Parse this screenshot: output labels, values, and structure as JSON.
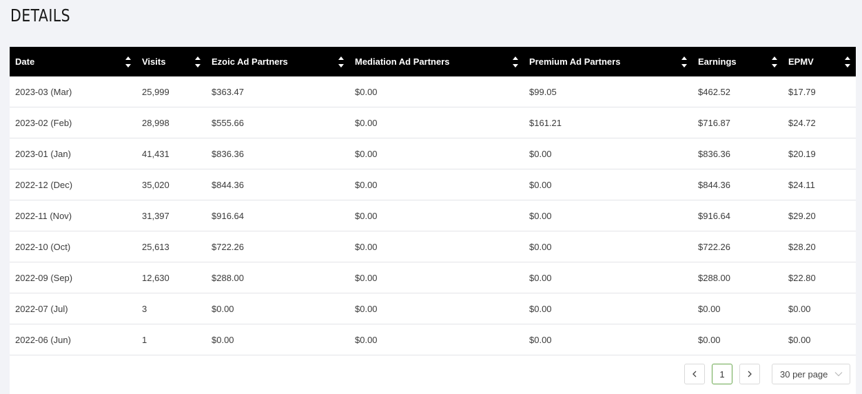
{
  "page": {
    "title": "DETAILS"
  },
  "table": {
    "columns": [
      "Date",
      "Visits",
      "Ezoic Ad Partners",
      "Mediation Ad Partners",
      "Premium Ad Partners",
      "Earnings",
      "EPMV"
    ],
    "rows": [
      [
        "2023-03 (Mar)",
        "25,999",
        "$363.47",
        "$0.00",
        "$99.05",
        "$462.52",
        "$17.79"
      ],
      [
        "2023-02 (Feb)",
        "28,998",
        "$555.66",
        "$0.00",
        "$161.21",
        "$716.87",
        "$24.72"
      ],
      [
        "2023-01 (Jan)",
        "41,431",
        "$836.36",
        "$0.00",
        "$0.00",
        "$836.36",
        "$20.19"
      ],
      [
        "2022-12 (Dec)",
        "35,020",
        "$844.36",
        "$0.00",
        "$0.00",
        "$844.36",
        "$24.11"
      ],
      [
        "2022-11 (Nov)",
        "31,397",
        "$916.64",
        "$0.00",
        "$0.00",
        "$916.64",
        "$29.20"
      ],
      [
        "2022-10 (Oct)",
        "25,613",
        "$722.26",
        "$0.00",
        "$0.00",
        "$722.26",
        "$28.20"
      ],
      [
        "2022-09 (Sep)",
        "12,630",
        "$288.00",
        "$0.00",
        "$0.00",
        "$288.00",
        "$22.80"
      ],
      [
        "2022-07 (Jul)",
        "3",
        "$0.00",
        "$0.00",
        "$0.00",
        "$0.00",
        "$0.00"
      ],
      [
        "2022-06 (Jun)",
        "1",
        "$0.00",
        "$0.00",
        "$0.00",
        "$0.00",
        "$0.00"
      ]
    ]
  },
  "pagination": {
    "current_page": "1",
    "per_page": "30 per page",
    "prev_icon": "chevron-left-icon",
    "next_icon": "chevron-right-icon",
    "dropdown_icon": "chevron-down-icon"
  },
  "colors": {
    "header_bg": "#000000",
    "active_page_border": "#6aa84f",
    "page_bg": "#f2f3f7"
  }
}
